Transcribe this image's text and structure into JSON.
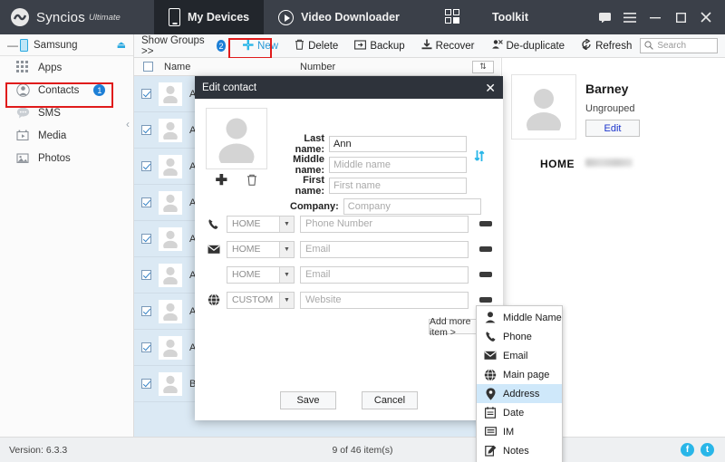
{
  "titlebar": {
    "brand": "Syncios",
    "brand_sub": "Ultimate",
    "tabs": [
      {
        "label": "My Devices",
        "icon": "phone-icon",
        "active": true
      },
      {
        "label": "Video Downloader",
        "icon": "play-circle-icon",
        "active": false
      },
      {
        "label": "Toolkit",
        "icon": "grid-squares-icon",
        "active": false
      }
    ],
    "window_buttons": [
      {
        "name": "feedback-button",
        "glyph": "⬛"
      },
      {
        "name": "menu-button",
        "glyph": "≡"
      },
      {
        "name": "minimize-button",
        "glyph": "─"
      },
      {
        "name": "maximize-button",
        "glyph": "□"
      },
      {
        "name": "close-button",
        "glyph": "✕"
      }
    ]
  },
  "sidebar": {
    "device": {
      "label": "Samsung",
      "collapse_glyph": "—",
      "eject_glyph": "⏏"
    },
    "items": [
      {
        "label": "Apps",
        "icon": "apps-grid-icon",
        "badge": ""
      },
      {
        "label": "Contacts",
        "icon": "contact-person-icon",
        "badge": "1"
      },
      {
        "label": "SMS",
        "icon": "message-bubble-icon",
        "badge": ""
      },
      {
        "label": "Media",
        "icon": "media-video-icon",
        "badge": ""
      },
      {
        "label": "Photos",
        "icon": "photo-image-icon",
        "badge": ""
      }
    ],
    "collapse_chevron": "‹"
  },
  "toolbar": {
    "show_groups": "Show Groups  >>",
    "groups_badge": "2",
    "buttons": [
      {
        "label": "New",
        "icon": "plus-icon"
      },
      {
        "label": "Delete",
        "icon": "trash-icon"
      },
      {
        "label": "Backup",
        "icon": "backup-icon"
      },
      {
        "label": "Recover",
        "icon": "recover-download-icon"
      },
      {
        "label": "De-duplicate",
        "icon": "deduplicate-icon"
      },
      {
        "label": "Refresh",
        "icon": "refresh-icon"
      }
    ],
    "search": {
      "placeholder": "Search",
      "value": "",
      "icon": "search-icon"
    }
  },
  "table": {
    "columns": [
      "Name",
      "Number"
    ],
    "sort_glyph": "⇅",
    "rows": [
      {
        "name": "Ali",
        "checked": true
      },
      {
        "name": "All",
        "checked": true
      },
      {
        "name": "An",
        "checked": true
      },
      {
        "name": "An",
        "checked": true
      },
      {
        "name": "An",
        "checked": true
      },
      {
        "name": "An",
        "checked": true
      },
      {
        "name": "Ac",
        "checked": true
      },
      {
        "name": "Au",
        "checked": true
      },
      {
        "name": "Ba",
        "checked": true
      }
    ]
  },
  "detail": {
    "name": "Barney",
    "group": "Ungrouped",
    "edit_label": "Edit",
    "phone_label": "HOME",
    "phone_value": ""
  },
  "modal": {
    "title": "Edit contact",
    "close_glyph": "✕",
    "avatar_add_glyph": "✚",
    "avatar_delete_icon": "trash-icon",
    "swap_icon": "swap-arrows-icon",
    "name_fields": [
      {
        "label": "Last name:",
        "value": "Ann",
        "placeholder": "Last name"
      },
      {
        "label": "Middle name:",
        "value": "",
        "placeholder": "Middle name"
      },
      {
        "label": "First name:",
        "value": "",
        "placeholder": "First name"
      },
      {
        "label": "Company:",
        "value": "",
        "placeholder": "Company"
      }
    ],
    "item_rows": [
      {
        "icon": "phone-handset-icon",
        "type": "HOME",
        "placeholder": "Phone Number",
        "value": ""
      },
      {
        "icon": "envelope-icon",
        "type": "HOME",
        "placeholder": "Email",
        "value": ""
      },
      {
        "icon": "",
        "type": "HOME",
        "placeholder": "Email",
        "value": ""
      },
      {
        "icon": "globe-icon",
        "type": "CUSTOM",
        "placeholder": "Website",
        "value": ""
      }
    ],
    "add_more_label": "Add more item >",
    "save_label": "Save",
    "cancel_label": "Cancel"
  },
  "context_menu": {
    "items": [
      {
        "label": "Middle Name",
        "icon": "person-icon",
        "highlighted": false
      },
      {
        "label": "Phone",
        "icon": "phone-handset-icon",
        "highlighted": false
      },
      {
        "label": "Email",
        "icon": "envelope-icon",
        "highlighted": false
      },
      {
        "label": "Main page",
        "icon": "globe-icon",
        "highlighted": false
      },
      {
        "label": "Address",
        "icon": "map-pin-icon",
        "highlighted": true
      },
      {
        "label": "Date",
        "icon": "calendar-icon",
        "highlighted": false
      },
      {
        "label": "IM",
        "icon": "chat-lines-icon",
        "highlighted": false
      },
      {
        "label": "Notes",
        "icon": "note-pencil-icon",
        "highlighted": false
      }
    ]
  },
  "statusbar": {
    "version": "Version: 6.3.3",
    "count": "9 of 46 item(s)",
    "socials": [
      {
        "name": "facebook-icon",
        "glyph": "f"
      },
      {
        "name": "twitter-icon",
        "glyph": "t"
      }
    ]
  },
  "colors": {
    "titlebar_bg": "#3b4049",
    "accent_cyan": "#29b6e8",
    "badge_blue": "#1d7fd6",
    "highlight_red": "#e01b1b",
    "menu_highlight": "#cfe8fa",
    "row_bg": "#dbe9f4"
  }
}
